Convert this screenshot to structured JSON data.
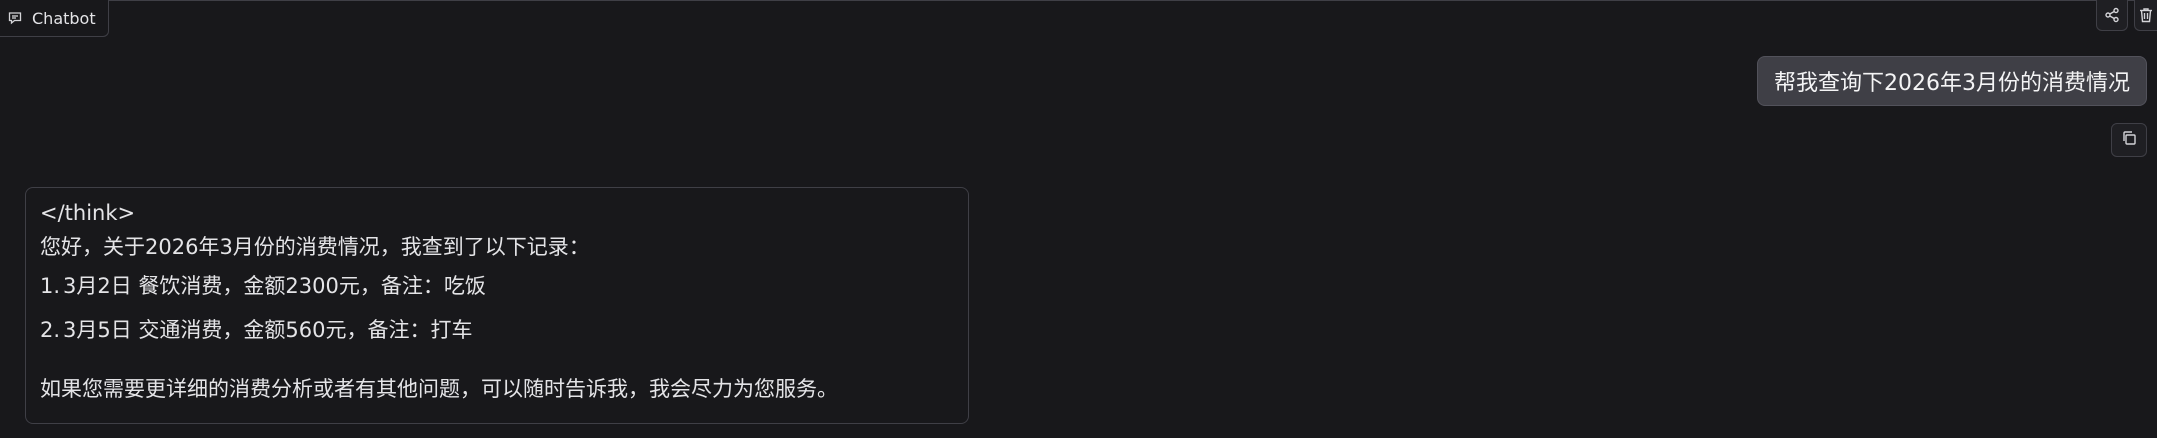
{
  "header": {
    "title": "Chatbot",
    "icons": [
      "chat-bubble-icon",
      "share-icon",
      "trash-icon"
    ]
  },
  "conversation": {
    "user_message": "帮我查询下2026年3月份的消费情况",
    "user_actions": {
      "copy_icon": "copy-icon"
    },
    "bot_message": {
      "think_tag": "</think>",
      "greeting": "您好，关于2026年3月份的消费情况，我查到了以下记录：",
      "items": [
        {
          "number": "1.",
          "text": "3月2日 餐饮消费，金额2300元，备注：吃饭"
        },
        {
          "number": "2.",
          "text": "3月5日 交通消费，金额560元，备注：打车"
        }
      ],
      "closing": "如果您需要更详细的消费分析或者有其他问题，可以随时告诉我，我会尽力为您服务。"
    }
  },
  "colors": {
    "background": "#18181b",
    "border": "#3f3f46",
    "user_bubble": "#3f3f46",
    "text": "#e4e4e7"
  }
}
